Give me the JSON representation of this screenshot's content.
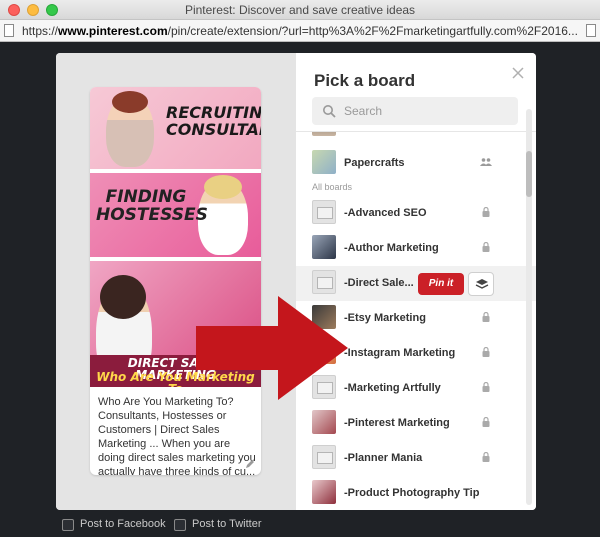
{
  "window": {
    "title": "Pinterest: Discover and save creative ideas"
  },
  "address_bar": {
    "scheme": "https://",
    "host": "www.pinterest.com",
    "path": "/pin/create/extension/?url=http%3A%2F%2Fmarketingartfully.com%2F2016..."
  },
  "pin": {
    "image_text_1": "RECRUITING CONSULTANTS",
    "image_text_2": "FINDING HOSTESSES",
    "banner_line_1": "DIRECT SALES MARKETING",
    "banner_line_2": "Who Are You Marketing To",
    "description": "Who Are You Marketing To? Consultants, Hostesses or Customers | Direct Sales Marketing ... When you are doing direct sales marketing you actually have three kinds of cu..."
  },
  "board_picker": {
    "title": "Pick a board",
    "search_placeholder": "Search",
    "section_label": "All boards",
    "pin_it_label": "Pin it",
    "boards": [
      {
        "name": "",
        "thumb": "image",
        "icon": "none"
      },
      {
        "name": "Papercrafts",
        "thumb": "image",
        "icon": "group-icon"
      },
      {
        "name": "-Advanced SEO",
        "thumb": "placeholder",
        "icon": "lock-icon"
      },
      {
        "name": "-Author Marketing",
        "thumb": "image",
        "icon": "lock-icon"
      },
      {
        "name": "-Direct Sale...",
        "thumb": "placeholder",
        "icon": "none"
      },
      {
        "name": "-Etsy Marketing",
        "thumb": "image",
        "icon": "lock-icon"
      },
      {
        "name": "-Instagram Marketing",
        "thumb": "image",
        "icon": "lock-icon"
      },
      {
        "name": "-Marketing Artfully",
        "thumb": "placeholder",
        "icon": "lock-icon"
      },
      {
        "name": "-Pinterest Marketing",
        "thumb": "image",
        "icon": "lock-icon"
      },
      {
        "name": "-Planner Mania",
        "thumb": "placeholder",
        "icon": "lock-icon"
      },
      {
        "name": "-Product Photography Tip",
        "thumb": "image",
        "icon": "lock-icon"
      }
    ]
  },
  "share": {
    "facebook_label": "Post to Facebook",
    "twitter_label": "Post to Twitter"
  },
  "colors": {
    "pin_it_red": "#cb2027",
    "arrow_red": "#c4161c",
    "backdrop": "#1f2226"
  }
}
